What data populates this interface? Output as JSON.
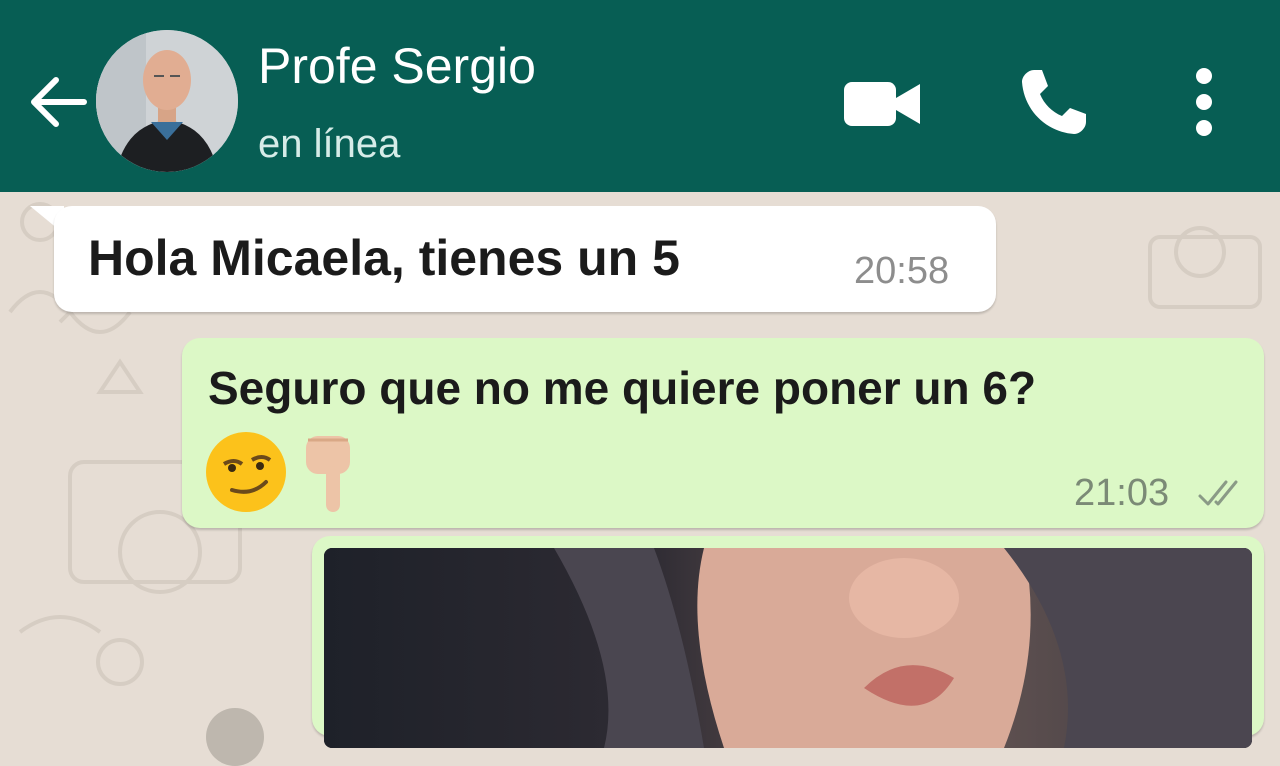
{
  "header": {
    "contact_name": "Profe Sergio",
    "status": "en línea",
    "bg_color": "#075e54",
    "icons": [
      "back-arrow-icon",
      "video-call-icon",
      "phone-icon",
      "more-vertical-icon"
    ]
  },
  "messages": [
    {
      "direction": "incoming",
      "text": "Hola Micaela, tienes un 5",
      "time": "20:58"
    },
    {
      "direction": "outgoing",
      "text": "Seguro que no me quiere poner un 6?",
      "emojis": [
        "😏",
        "👇🏼"
      ],
      "time": "21:03",
      "status": "read-ticks"
    },
    {
      "direction": "outgoing",
      "type": "image"
    }
  ],
  "colors": {
    "incoming_bubble": "#ffffff",
    "outgoing_bubble": "#dcf8c6",
    "chat_bg": "#e6ddd4"
  }
}
